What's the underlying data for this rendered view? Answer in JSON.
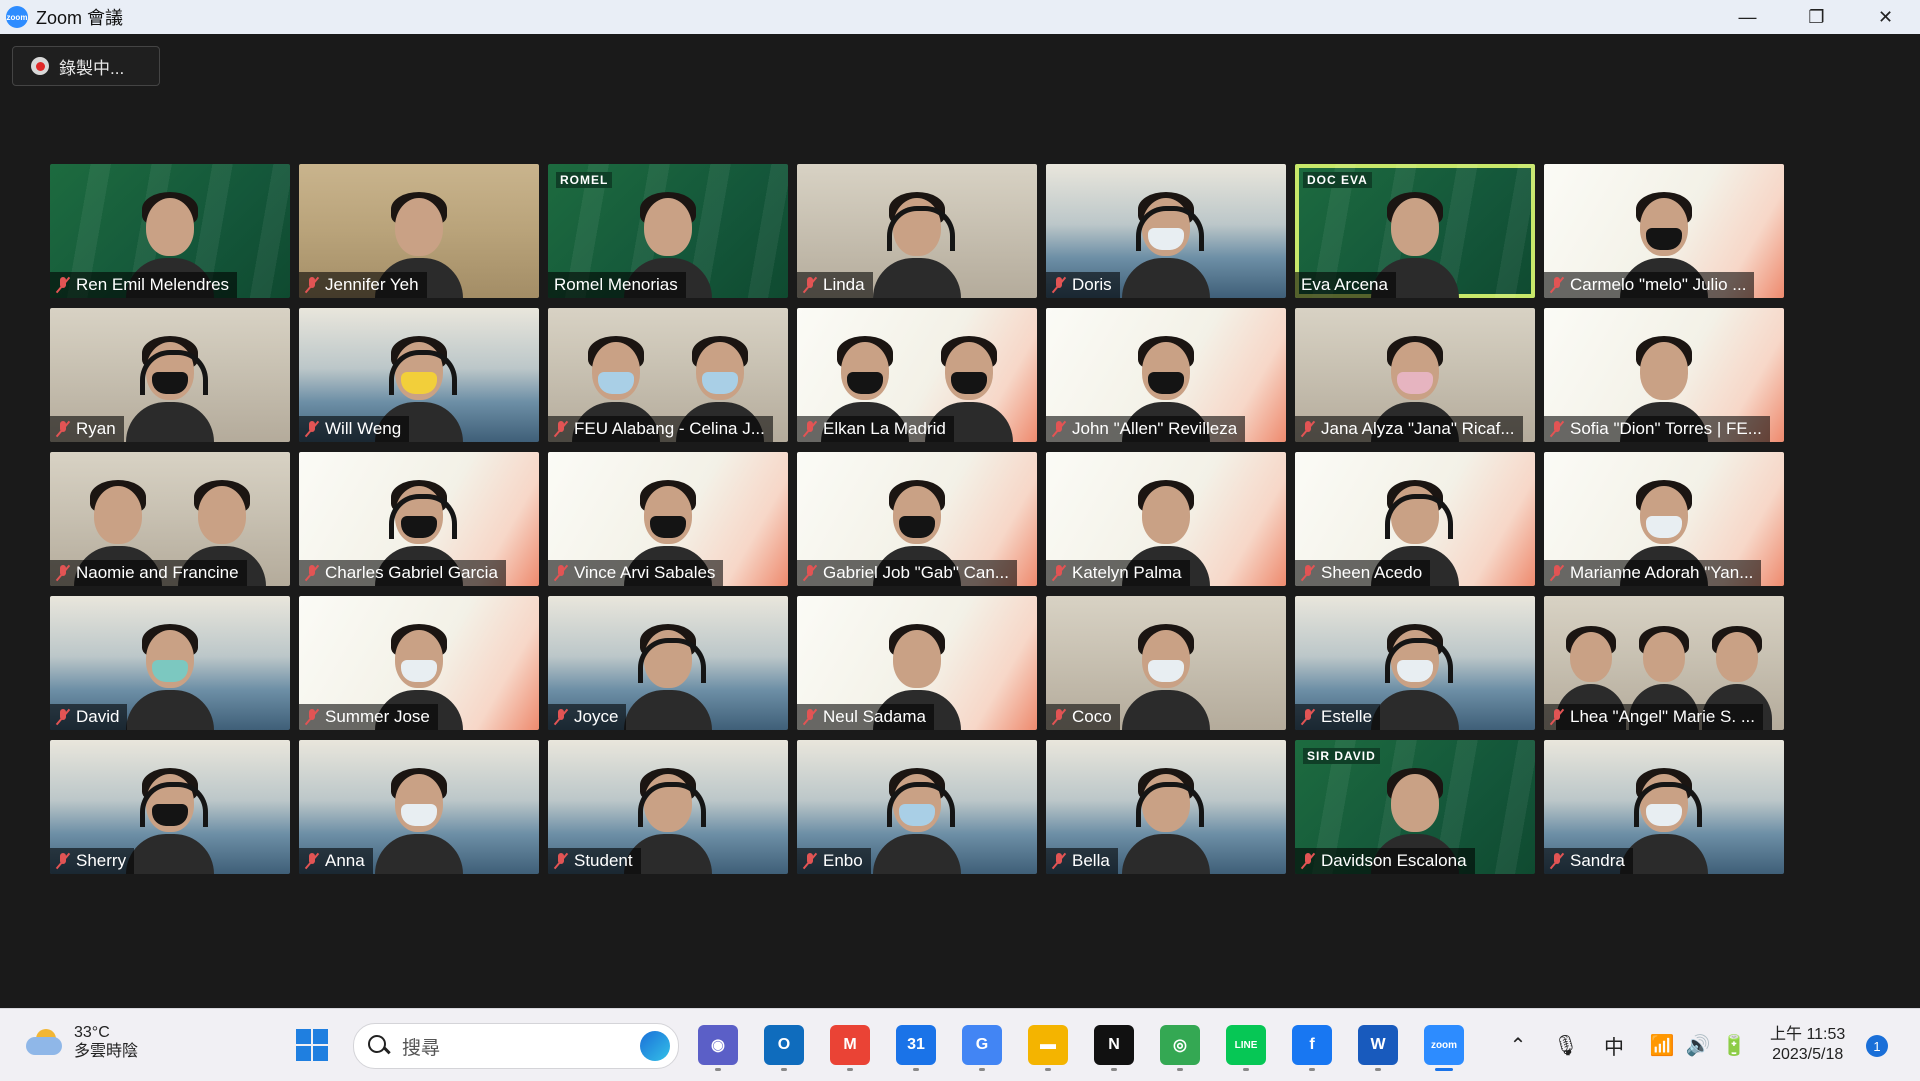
{
  "window": {
    "title": "Zoom 會議",
    "minimize": "—",
    "maximize": "❐",
    "close": "✕"
  },
  "recording": {
    "label": "錄製中..."
  },
  "participants": [
    {
      "name": "Ren Emil Melendres",
      "muted": true,
      "bg": "green",
      "look": "none"
    },
    {
      "name": "Jennifer Yeh",
      "muted": true,
      "bg": "paint",
      "look": "none"
    },
    {
      "name": "Romel Menorias",
      "muted": false,
      "bg": "green",
      "look": "none",
      "badge": "ROMEL"
    },
    {
      "name": "Linda",
      "muted": true,
      "bg": "office",
      "look": "headset"
    },
    {
      "name": "Doris",
      "muted": true,
      "bg": "class",
      "look": "white-headset"
    },
    {
      "name": "Eva Arcena",
      "muted": false,
      "bg": "green",
      "look": "none",
      "badge": "DOC EVA",
      "active": true
    },
    {
      "name": "Carmelo \"melo\" Julio ...",
      "muted": true,
      "bg": "feu",
      "look": "black"
    },
    {
      "name": "Ryan",
      "muted": true,
      "bg": "office",
      "look": "black-headset"
    },
    {
      "name": "Will Weng",
      "muted": true,
      "bg": "class",
      "look": "yellow-headset"
    },
    {
      "name": "FEU Alabang - Celina J...",
      "muted": true,
      "bg": "office",
      "look": "duo-blue"
    },
    {
      "name": "Elkan La Madrid",
      "muted": true,
      "bg": "feu",
      "look": "duo-black"
    },
    {
      "name": "John \"Allen\" Revilleza",
      "muted": true,
      "bg": "feu",
      "look": "black"
    },
    {
      "name": "Jana Alyza \"Jana\" Ricaf...",
      "muted": true,
      "bg": "office",
      "look": "pink"
    },
    {
      "name": "Sofia \"Dion\" Torres | FE...",
      "muted": true,
      "bg": "feu",
      "look": "none"
    },
    {
      "name": "Naomie and Francine",
      "muted": true,
      "bg": "office",
      "look": "duo"
    },
    {
      "name": "Charles Gabriel Garcia",
      "muted": true,
      "bg": "feu",
      "look": "black-headset"
    },
    {
      "name": "Vince Arvi Sabales",
      "muted": true,
      "bg": "feu",
      "look": "black"
    },
    {
      "name": "Gabriel Job \"Gab\" Can...",
      "muted": true,
      "bg": "feu",
      "look": "black"
    },
    {
      "name": "Katelyn Palma",
      "muted": true,
      "bg": "feu",
      "look": "none"
    },
    {
      "name": "Sheen Acedo",
      "muted": true,
      "bg": "feu",
      "look": "headset"
    },
    {
      "name": "Marianne Adorah \"Yan...",
      "muted": true,
      "bg": "feu",
      "look": "white"
    },
    {
      "name": "David",
      "muted": true,
      "bg": "class",
      "look": "teal"
    },
    {
      "name": "Summer Jose",
      "muted": true,
      "bg": "feu",
      "look": "white"
    },
    {
      "name": "Joyce",
      "muted": true,
      "bg": "class",
      "look": "headset"
    },
    {
      "name": "Neul Sadama",
      "muted": true,
      "bg": "feu",
      "look": "none"
    },
    {
      "name": "Coco",
      "muted": true,
      "bg": "office",
      "look": "white"
    },
    {
      "name": "Estelle",
      "muted": true,
      "bg": "class",
      "look": "white-headset"
    },
    {
      "name": "Lhea \"Angel\" Marie S. ...",
      "muted": true,
      "bg": "office",
      "look": "trio"
    },
    {
      "name": "Sherry",
      "muted": true,
      "bg": "class",
      "look": "black-headset"
    },
    {
      "name": "Anna",
      "muted": true,
      "bg": "class",
      "look": "white"
    },
    {
      "name": "Student",
      "muted": true,
      "bg": "class",
      "look": "headset"
    },
    {
      "name": "Enbo",
      "muted": true,
      "bg": "class",
      "look": "blue-headset"
    },
    {
      "name": "Bella",
      "muted": true,
      "bg": "class",
      "look": "headset"
    },
    {
      "name": "Davidson Escalona",
      "muted": true,
      "bg": "green",
      "look": "none",
      "badge": "SIR DAVID"
    },
    {
      "name": "Sandra",
      "muted": true,
      "bg": "class",
      "look": "white-headset"
    }
  ],
  "taskbar": {
    "weather_temp": "33°C",
    "weather_desc": "多雲時陰",
    "search_placeholder": "搜尋",
    "apps": [
      {
        "name": "teams-chat",
        "color": "#5b5fc7",
        "label": "◉"
      },
      {
        "name": "outlook",
        "color": "#0f6cbd",
        "label": "O"
      },
      {
        "name": "gmail",
        "color": "#ea4335",
        "label": "M"
      },
      {
        "name": "google-calendar",
        "color": "#1a73e8",
        "label": "31"
      },
      {
        "name": "google-translate",
        "color": "#4285f4",
        "label": "G"
      },
      {
        "name": "file-explorer",
        "color": "#f4b400",
        "label": "▬"
      },
      {
        "name": "notion",
        "color": "#111111",
        "label": "N"
      },
      {
        "name": "chrome",
        "color": "#34a853",
        "label": "◎"
      },
      {
        "name": "line",
        "color": "#06c755",
        "label": "LINE"
      },
      {
        "name": "facebook",
        "color": "#1877f2",
        "label": "f"
      },
      {
        "name": "word",
        "color": "#185abd",
        "label": "W"
      },
      {
        "name": "zoom",
        "color": "#2d8cff",
        "label": "zoom"
      }
    ],
    "tray_ime": "中",
    "clock_time": "上午 11:53",
    "clock_date": "2023/5/18",
    "notifications": "1"
  }
}
